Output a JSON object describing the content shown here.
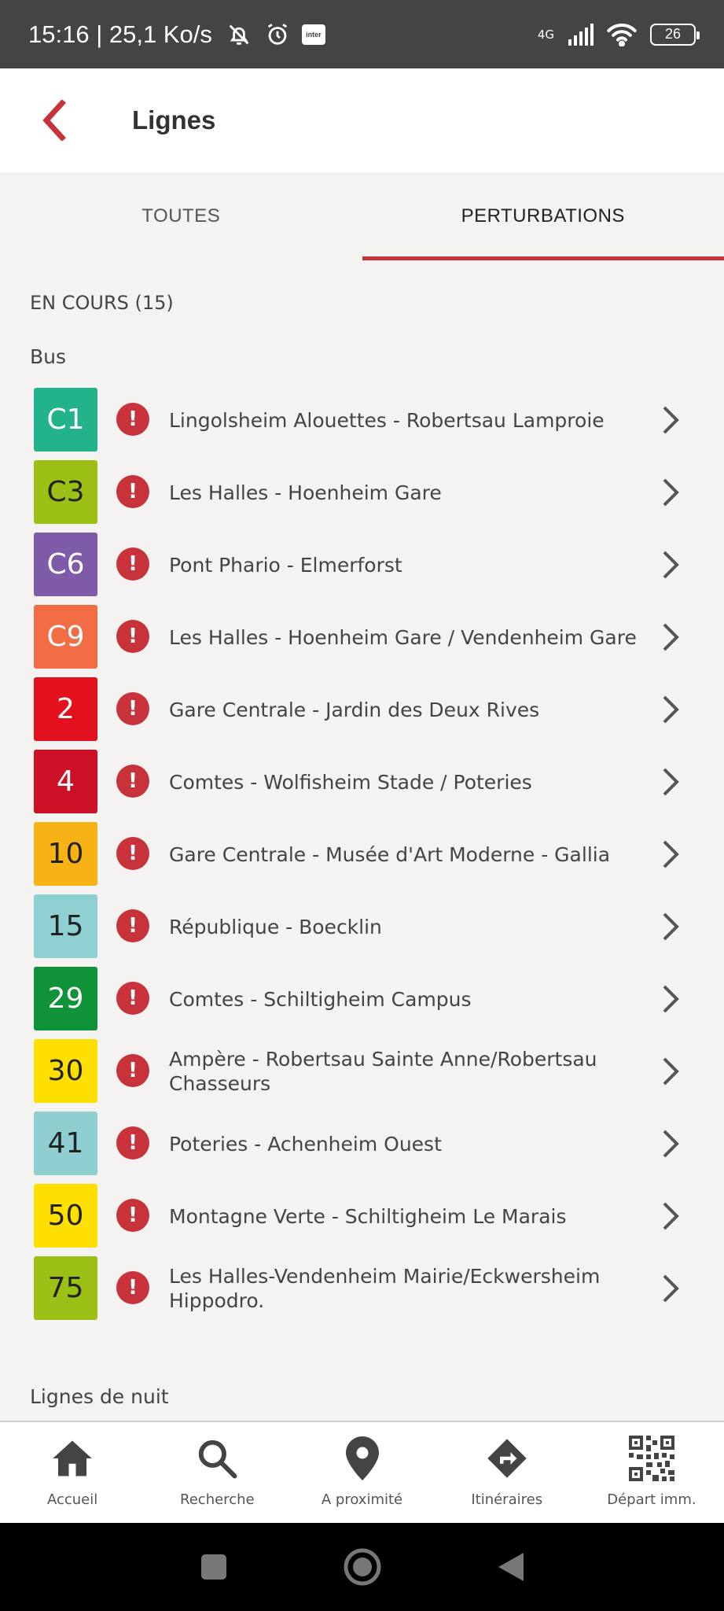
{
  "status_bar": {
    "time_speed": "15:16 | 25,1 Ko/s",
    "inter_label": "inter",
    "network_type": "4G",
    "battery_level": "26"
  },
  "header": {
    "title": "Lignes"
  },
  "tabs": [
    {
      "label": "TOUTES",
      "active": false
    },
    {
      "label": "PERTURBATIONS",
      "active": true
    }
  ],
  "content": {
    "ongoing_count_label": "EN COURS (15)",
    "bus_section_label": "Bus",
    "night_section_label": "Lignes de nuit",
    "lines": [
      {
        "code": "C1",
        "name": "Lingolsheim Alouettes - Robertsau Lamproie",
        "bg": "#22b38a",
        "fg": "#ffffff"
      },
      {
        "code": "C3",
        "name": "Les Halles - Hoenheim Gare",
        "bg": "#9dc017",
        "fg": "#222222"
      },
      {
        "code": "C6",
        "name": "Pont Phario - Elmerforst",
        "bg": "#7f5aa8",
        "fg": "#ffffff"
      },
      {
        "code": "C9",
        "name": "Les Halles - Hoenheim Gare / Vendenheim Gare",
        "bg": "#f26c44",
        "fg": "#ffffff"
      },
      {
        "code": "2",
        "name": "Gare Centrale - Jardin des Deux Rives",
        "bg": "#e3101e",
        "fg": "#ffffff"
      },
      {
        "code": "4",
        "name": "Comtes - Wolfisheim Stade / Poteries",
        "bg": "#cc1126",
        "fg": "#ffffff"
      },
      {
        "code": "10",
        "name": "Gare Centrale - Musée d'Art Moderne - Gallia",
        "bg": "#f7b315",
        "fg": "#222222"
      },
      {
        "code": "15",
        "name": "République -  Boecklin",
        "bg": "#8fd1d3",
        "fg": "#222222"
      },
      {
        "code": "29",
        "name": "Comtes  - Schiltigheim Campus",
        "bg": "#0f9238",
        "fg": "#ffffff"
      },
      {
        "code": "30",
        "name": "Ampère - Robertsau Sainte Anne/Robertsau Chasseurs",
        "bg": "#fedf00",
        "fg": "#222222"
      },
      {
        "code": "41",
        "name": "Poteries - Achenheim Ouest",
        "bg": "#8fcfd2",
        "fg": "#222222"
      },
      {
        "code": "50",
        "name": "Montagne Verte - Schiltigheim Le Marais",
        "bg": "#fedf00",
        "fg": "#222222"
      },
      {
        "code": "75",
        "name": "Les Halles-Vendenheim Mairie/Eckwersheim Hippodro.",
        "bg": "#9dc017",
        "fg": "#222222"
      }
    ]
  },
  "bottom_nav": [
    {
      "label": "Accueil",
      "icon": "home-icon"
    },
    {
      "label": "Recherche",
      "icon": "search-icon"
    },
    {
      "label": "A proximité",
      "icon": "location-pin-icon"
    },
    {
      "label": "Itinéraires",
      "icon": "directions-icon"
    },
    {
      "label": "Départ imm.",
      "icon": "qr-code-icon"
    }
  ],
  "colors": {
    "accent": "#c8323a",
    "background": "#f4f3f1"
  }
}
